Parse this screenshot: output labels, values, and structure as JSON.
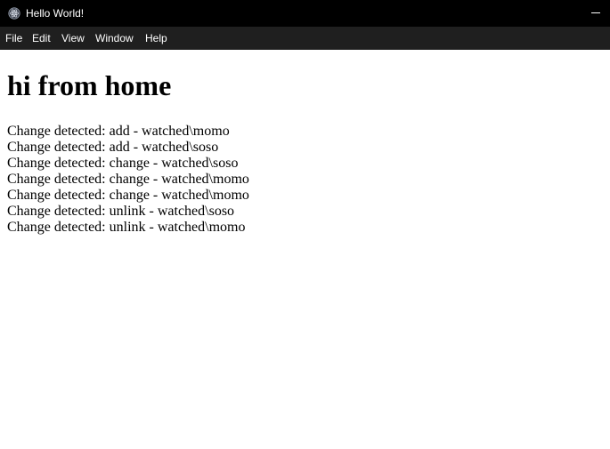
{
  "window": {
    "title": "Hello World!",
    "icon": "electron-icon",
    "colors": {
      "titlebar": "#000000",
      "menubar": "#1f1f1f",
      "text": "#ffffff"
    }
  },
  "menu": {
    "items": [
      {
        "label": "File"
      },
      {
        "label": "Edit"
      },
      {
        "label": "View"
      },
      {
        "label": "Window"
      },
      {
        "label": "Help"
      }
    ]
  },
  "main": {
    "heading": "hi from home",
    "log": [
      "Change detected: add - watched\\momo",
      "Change detected: add - watched\\soso",
      "Change detected: change - watched\\soso",
      "Change detected: change - watched\\momo",
      "Change detected: change - watched\\momo",
      "Change detected: unlink - watched\\soso",
      "Change detected: unlink - watched\\momo"
    ]
  }
}
